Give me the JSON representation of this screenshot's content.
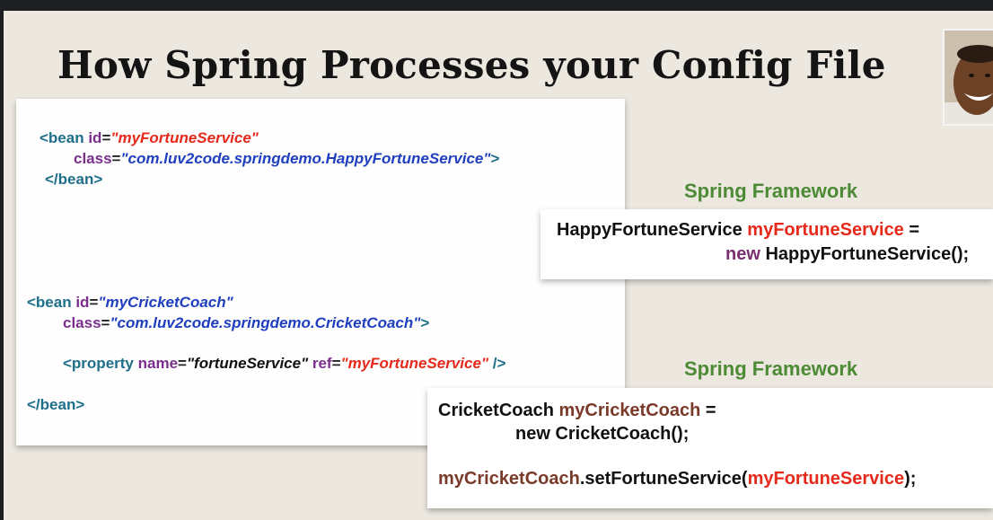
{
  "slide": {
    "title": "How Spring Processes your Config File"
  },
  "xml_bean1": {
    "line1_tag": "<bean",
    "line1_attr": " id",
    "line1_eq": "=",
    "line1_val": "\"myFortuneService\"",
    "line2_attr": "class",
    "line2_eq": "=",
    "line2_val": "\"com.luv2code.springdemo.HappyFortuneService\"",
    "line2_close": ">",
    "line3": "</bean>"
  },
  "xml_bean2": {
    "line1_tag": "<bean",
    "line1_attr": " id",
    "line1_eq": "=",
    "line1_val": "\"myCricketCoach\"",
    "line2_attr": "class",
    "line2_eq": "=",
    "line2_val": "\"com.luv2code.springdemo.CricketCoach\"",
    "line2_close": ">",
    "prop_tag": "<property",
    "prop_name_attr": " name",
    "prop_eq1": "=",
    "prop_name_val": "\"fortuneService\"",
    "prop_ref_attr": " ref",
    "prop_eq2": "=",
    "prop_ref_val": "\"myFortuneService\"",
    "prop_close": " />",
    "close": "</bean>"
  },
  "framework1": {
    "label": "Spring Framework",
    "type": "HappyFortuneService ",
    "var": "myFortuneService",
    "assign": " =",
    "new_kw": "new",
    "ctor": " HappyFortuneService();"
  },
  "framework2": {
    "label": "Spring Framework",
    "type": "CricketCoach ",
    "var": "myCricketCoach",
    "assign": " =",
    "ctor": "new CricketCoach();",
    "call_obj": "myCricketCoach",
    "call_method": ".setFortuneService(",
    "call_arg": "myFortuneService",
    "call_end": ");"
  },
  "colors": {
    "tag": "#1f6f8b",
    "attr": "#7a2f8c",
    "value_blue": "#1f3fbf",
    "value_red": "#e6291a",
    "framework_green": "#4d8a35"
  }
}
